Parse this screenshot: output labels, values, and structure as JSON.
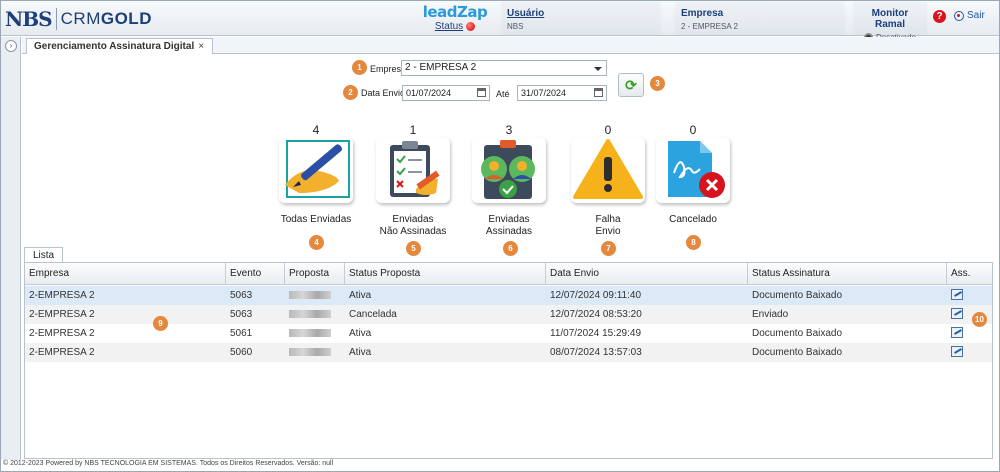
{
  "header": {
    "logo_nbs": "NBS",
    "logo_crm": "CRM",
    "logo_gold": "GOLD",
    "leadzap_brand": "leadZap",
    "leadzap_status": "Status",
    "usuario_label": "Usuário",
    "usuario_value": "NBS",
    "empresa_label": "Empresa",
    "empresa_value": "2 - EMPRESA 2",
    "monitor_label": "Monitor Ramal",
    "monitor_value": "Desativado",
    "help": "?",
    "sair": "Sair"
  },
  "tab": {
    "title": "Gerenciamento Assinatura Digital",
    "close": "×"
  },
  "form": {
    "empresa_label": "Empresa",
    "empresa_value": "2 - EMPRESA 2",
    "data_envio_label": "Data Envio",
    "data_de": "01/07/2024",
    "ate_label": "Até",
    "data_ate": "31/07/2024",
    "badges": [
      "1",
      "2",
      "3"
    ]
  },
  "stats": [
    {
      "count": "4",
      "label1": "Todas Enviadas",
      "label2": "",
      "badge": "4",
      "icon": "pen-signing-icon"
    },
    {
      "count": "1",
      "label1": "Enviadas",
      "label2": "Não Assinadas",
      "badge": "5",
      "icon": "clipboard-checklist-icon"
    },
    {
      "count": "3",
      "label1": "Enviadas",
      "label2": "Assinadas",
      "badge": "6",
      "icon": "users-approved-icon"
    },
    {
      "count": "0",
      "label1": "Falha",
      "label2": "Envio",
      "badge": "7",
      "icon": "warning-icon"
    },
    {
      "count": "0",
      "label1": "Cancelado",
      "label2": "",
      "badge": "8",
      "icon": "document-cancel-icon"
    }
  ],
  "lista": {
    "tab": "Lista",
    "columns": [
      "Empresa",
      "Evento",
      "Proposta",
      "Status Proposta",
      "Data Envio",
      "Status Assinatura",
      "Ass."
    ],
    "rows": [
      {
        "empresa": "2-EMPRESA 2",
        "evento": "5063",
        "status_proposta": "Ativa",
        "data_envio": "12/07/2024 09:11:40",
        "status_assinatura": "Documento Baixado"
      },
      {
        "empresa": "2-EMPRESA 2",
        "evento": "5063",
        "status_proposta": "Cancelada",
        "data_envio": "12/07/2024 08:53:20",
        "status_assinatura": "Enviado"
      },
      {
        "empresa": "2-EMPRESA 2",
        "evento": "5061",
        "status_proposta": "Ativa",
        "data_envio": "11/07/2024 15:29:49",
        "status_assinatura": "Documento Baixado"
      },
      {
        "empresa": "2-EMPRESA 2",
        "evento": "5060",
        "status_proposta": "Ativa",
        "data_envio": "08/07/2024 13:57:03",
        "status_assinatura": "Documento Baixado"
      }
    ],
    "badge_grid": "9",
    "badge_ass": "10"
  },
  "footer": "© 2012-2023 Powered by NBS TECNOLOGIA EM SISTEMAS. Todos os Direitos Reservados.   Versão: null",
  "colors": {
    "accent": "#1d3f7a",
    "badge": "#e4883d",
    "selected_row": "#dceaf7"
  }
}
